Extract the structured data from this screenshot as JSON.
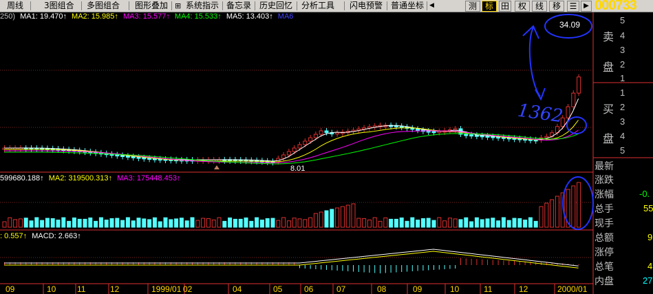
{
  "toolbar": {
    "items": [
      "周线",
      "3图组合",
      "多图组合",
      "图形叠加",
      "系统指示",
      "备忘录",
      "历史回忆",
      "分析工具",
      "闪电预警",
      "普通坐标"
    ],
    "right_buttons": [
      "测",
      "标",
      "田",
      "权",
      "线",
      "移"
    ],
    "stock_code": "000733"
  },
  "legend_main": {
    "prefix": "250)",
    "ma1": "MA1: 19.470↑",
    "ma2": "MA2: 15.985↑",
    "ma3": "MA3: 15.577↑",
    "ma4": "MA4: 15.533↑",
    "ma5": "MA5: 13.403↑",
    "ma6": "MA6",
    "colors": {
      "ma1": "#ffffff",
      "ma2": "#ffff00",
      "ma3": "#ff00ff",
      "ma4": "#00ff00",
      "ma5": "#ffffff",
      "ma6": "#0000ff"
    }
  },
  "legend_volume": {
    "ma1": "599680.188↑",
    "ma2": "MA2: 319500.313↑",
    "ma3": "MA3: 175448.453↑"
  },
  "legend_macd": {
    "dea": ": 0.557↑",
    "macd": "MACD: 2.663↑"
  },
  "annotations": {
    "high_price": "34.09",
    "low_price": "8.01",
    "handwritten_note": "1362"
  },
  "x_axis": [
    "09",
    "10",
    "11",
    "12",
    "1999/01",
    "02",
    "04",
    "05",
    "06",
    "07",
    "08",
    "09",
    "10",
    "11",
    "12",
    "2000/01"
  ],
  "order_book": {
    "sell_label_1": "卖",
    "sell_label_2": "盘",
    "buy_label_1": "买",
    "buy_label_2": "盘",
    "sell_levels": [
      "5",
      "4",
      "3",
      "2",
      "1"
    ],
    "buy_levels": [
      "1",
      "2",
      "3",
      "4",
      "5"
    ]
  },
  "stats": {
    "labels": [
      "最新",
      "涨跌",
      "涨幅",
      "总手",
      "现手",
      "总额",
      "涨停",
      "总笔",
      "内盘"
    ],
    "values": [
      "",
      "",
      "-0.",
      "55",
      "",
      "9",
      "",
      "4",
      "27"
    ]
  },
  "chart_data": {
    "type": "candlestick",
    "title": "000733 周线",
    "price_high": 34.09,
    "price_low": 8.01,
    "ma_values": {
      "MA1": 19.47,
      "MA2": 15.985,
      "MA3": 15.577,
      "MA4": 15.533,
      "MA5": 13.403
    },
    "volume_ma": {
      "MA1": 599680.188,
      "MA2": 319500.313,
      "MA3": 175448.453
    },
    "macd": {
      "DEA": 0.557,
      "MACD": 2.663
    },
    "x_ticks": [
      "09",
      "10",
      "11",
      "12",
      "1999/01",
      "02",
      "04",
      "05",
      "06",
      "07",
      "08",
      "09",
      "10",
      "11",
      "12",
      "2000/01"
    ]
  }
}
